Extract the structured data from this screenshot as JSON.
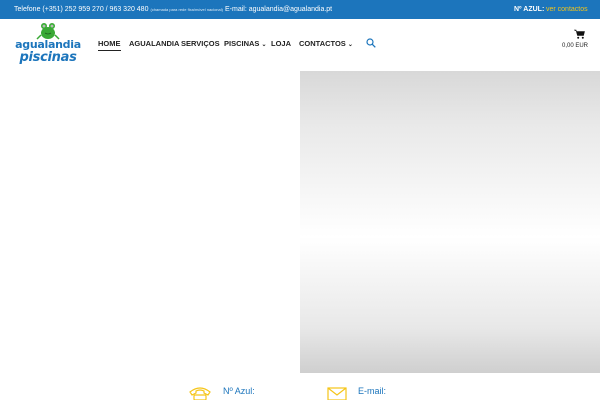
{
  "topbar": {
    "phone": "Telefone (+351) 252 959 270 / 963 320 480",
    "phone_note": "(chamada para rede fixa/móvel nacional)",
    "email": "E-mail: agualandia@agualandia.pt",
    "azul_label": "Nº AZUL:",
    "ver_contactos": "ver contactos"
  },
  "logo": {
    "line1": "agualandia",
    "line2": "piscinas"
  },
  "nav": {
    "home": "HOME",
    "agualandia": "AGUALANDIA",
    "servicos": "SERVIÇOS",
    "piscinas": "PISCINAS",
    "loja": "LOJA",
    "contactos": "CONTACTOS",
    "chevron": "⌄"
  },
  "cart": {
    "total": "0,00 EUR"
  },
  "contacts": {
    "azul_label": "Nº Azul:",
    "email_label": "E-mail:"
  },
  "colors": {
    "brand_blue": "#1c75bc",
    "accent_yellow": "#f5c518"
  }
}
